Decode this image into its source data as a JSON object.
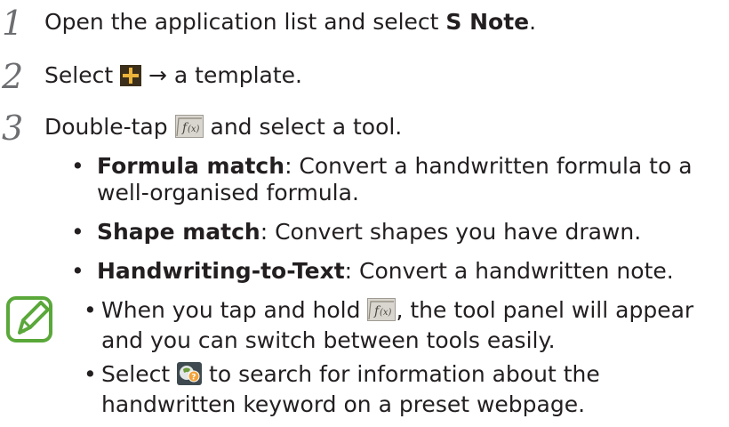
{
  "steps": [
    {
      "number": "1",
      "text_before": "Open the application list and select ",
      "bold": "S Note",
      "text_after": "."
    },
    {
      "number": "2",
      "text_before": "Select ",
      "text_after": " → a template.",
      "icon": "add-icon"
    },
    {
      "number": "3",
      "text_before": "Double-tap ",
      "text_after": " and select a tool.",
      "icon": "formula-tool-icon"
    }
  ],
  "tools": [
    {
      "name": "Formula match",
      "description": ": Convert a handwritten formula to a",
      "description_line2": "well-organised formula."
    },
    {
      "name": "Shape match",
      "description": ": Convert shapes you have drawn."
    },
    {
      "name": "Handwriting-to-Text",
      "description": ": Convert a handwritten note."
    }
  ],
  "notes": [
    {
      "text_before": "When you tap and hold ",
      "text_after": ", the tool panel will appear",
      "line2": "and you can switch between tools easily.",
      "icon": "formula-tool-icon"
    },
    {
      "text_before": "Select ",
      "text_after": " to search for information about the",
      "line2": "handwritten keyword on a preset webpage.",
      "icon": "web-search-icon"
    }
  ],
  "colors": {
    "text": "#231f20",
    "step_number": "#6d6e71",
    "note_icon": "#5aa83a",
    "add_icon_bg": "#3b2e1a",
    "add_icon_plus": "#ecb43b"
  }
}
